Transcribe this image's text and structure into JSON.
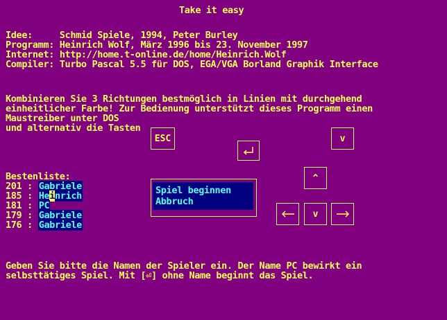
{
  "title": "Take it easy",
  "info": {
    "idee": "Idee:     Schmid Spiele, 1994, Peter Burley",
    "programm": "Programm: Heinrich Wolf, März 1996 bis 23. November 1997",
    "internet": "Internet: http://home.t-online.de/home/Heinrich.Wolf",
    "compiler": "Compiler: Turbo Pascal 5.5 für DOS, EGA/VGA Borland Graphik Interface"
  },
  "description": {
    "line1": "Kombinieren Sie 3 Richtungen bestmöglich in Linien mit durchgehend",
    "line2": "einheitlicher Farbe! Zur Bedienung unterstützt dieses Programm einen",
    "line3": "Maustreiber unter DOS",
    "line4": "und alternativ die Tasten"
  },
  "keys": {
    "esc": "ESC",
    "down_top": "v",
    "up": "^",
    "down": "v"
  },
  "highscore": {
    "heading": "Bestenliste:",
    "entries": [
      {
        "score": "201",
        "sep": " : ",
        "name": "Gabriele"
      },
      {
        "score": "185",
        "sep": " : ",
        "name_pre": "He",
        "name_cursor": "i",
        "name_post": "nrich"
      },
      {
        "score": "181",
        "sep": " : ",
        "name": "PC"
      },
      {
        "score": "179",
        "sep": " : ",
        "name": "Gabriele"
      },
      {
        "score": "176",
        "sep": " : ",
        "name": "Gabriele"
      }
    ]
  },
  "menu": {
    "start": "Spiel beginnen",
    "abort": "Abbruch"
  },
  "footer": {
    "line1": "Geben Sie bitte die Namen der Spieler ein. Der Name PC bewirkt ein",
    "line2": "selbsttätiges Spiel. Mit [⏎] ohne Name beginnt das Spiel."
  },
  "colors": {
    "background": "#800080",
    "text": "#FFFF55",
    "field_bg": "#000080",
    "field_text": "#55FFFF"
  }
}
